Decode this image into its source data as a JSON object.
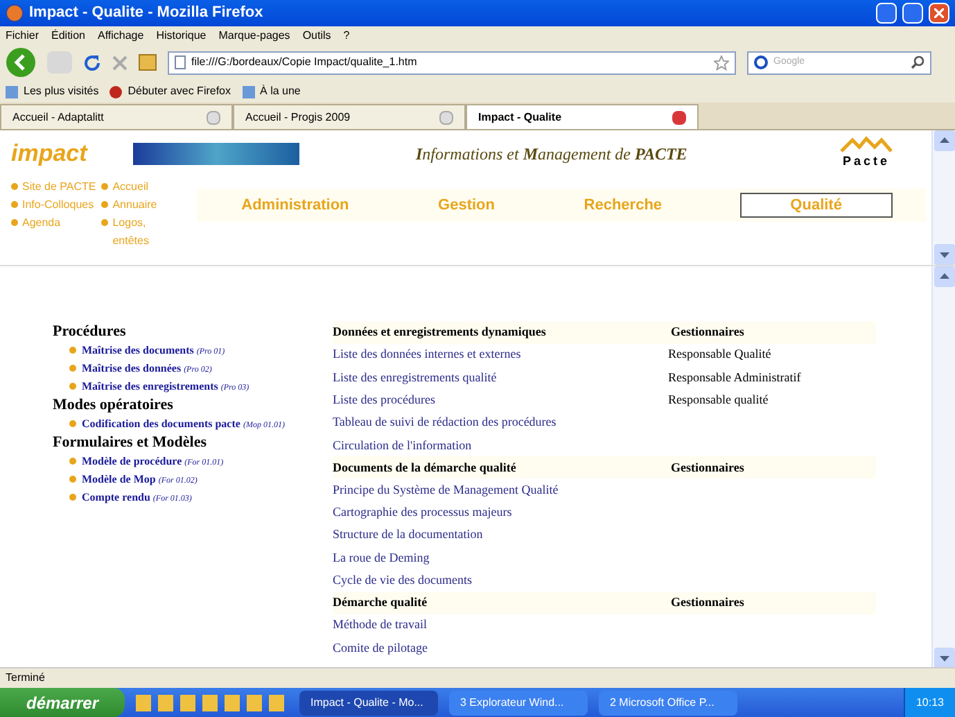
{
  "window": {
    "title": "Impact - Qualite - Mozilla Firefox"
  },
  "menu": [
    "Fichier",
    "Édition",
    "Affichage",
    "Historique",
    "Marque-pages",
    "Outils",
    "?"
  ],
  "address": {
    "value": "file:///G:/bordeaux/Copie Impact/qualite_1.htm"
  },
  "search": {
    "placeholder": "Google"
  },
  "bookmarks": [
    "Les plus visités",
    "Débuter avec Firefox",
    "À la une"
  ],
  "tabs": [
    {
      "label": "Accueil - Adaptalitt",
      "selected": false
    },
    {
      "label": "Accueil - Progis 2009",
      "selected": false
    },
    {
      "label": "Impact - Qualite",
      "selected": true
    }
  ],
  "header": {
    "logo": "impact",
    "tagline": "**I**nformations et **M**anagement de **PACTE**",
    "brand": "Pacte"
  },
  "quick_links": [
    [
      "Site de PACTE",
      "Info-Colloques",
      "Agenda"
    ],
    [
      "Accueil",
      "Annuaire",
      "Logos, entêtes"
    ]
  ],
  "sections_nav": [
    {
      "label": "Administration",
      "selected": false
    },
    {
      "label": "Gestion",
      "selected": false
    },
    {
      "label": "Recherche",
      "selected": false
    },
    {
      "label": "Qualité",
      "selected": true
    }
  ],
  "documents": [
    {
      "heading": "Procédures",
      "items": [
        {
          "label": "Maîtrise des documents",
          "code": "(Pro 01)"
        },
        {
          "label": "Maîtrise des données",
          "code": "(Pro 02)"
        },
        {
          "label": "Maîtrise des enregistrements",
          "code": "(Pro 03)"
        }
      ]
    },
    {
      "heading": "Modes opératoires",
      "items": [
        {
          "label": "Codification des documents pacte",
          "code": "(Mop 01.01)"
        }
      ]
    },
    {
      "heading": "Formulaires et Modèles",
      "items": [
        {
          "label": "Modèle de procédure",
          "code": "(For 01.01)"
        },
        {
          "label": "Modèle de Mop",
          "code": "(For 01.02)"
        },
        {
          "label": "Compte rendu",
          "code": "(For 01.03)"
        }
      ]
    }
  ],
  "tables": [
    {
      "heading": "Données et enregistrements dynamiques",
      "managers_heading": "Gestionnaires",
      "rows": [
        {
          "label": "Liste des données internes et externes",
          "manager": "Responsable Qualité"
        },
        {
          "label": "Liste des enregistrements qualité",
          "manager": "Responsable Administratif"
        },
        {
          "label": "Liste des procédures",
          "manager": "Responsable qualité"
        },
        {
          "label": "Tableau de suivi de rédaction des procédures"
        },
        {
          "label": "Circulation de l'information"
        }
      ]
    },
    {
      "heading": "Documents de la démarche qualité",
      "managers_heading": "Gestionnaires",
      "rows": [
        {
          "label": "Principe du Système de Management Qualité"
        },
        {
          "label": "Cartographie des processus majeurs"
        },
        {
          "label": "Structure de la documentation"
        },
        {
          "label": "La roue de Deming"
        },
        {
          "label": "Cycle de vie des documents"
        }
      ]
    },
    {
      "heading": "Démarche qualité",
      "managers_heading": "Gestionnaires",
      "rows": [
        {
          "label": "Méthode de travail"
        },
        {
          "label": "Comite de pilotage"
        }
      ]
    }
  ],
  "status_bar": "Terminé",
  "taskbar": {
    "start": "démarrer",
    "windows": [
      "Impact - Qualite - Mo...",
      "3 Explorateur Wind...",
      "2 Microsoft Office P..."
    ],
    "clock": "10:13"
  }
}
